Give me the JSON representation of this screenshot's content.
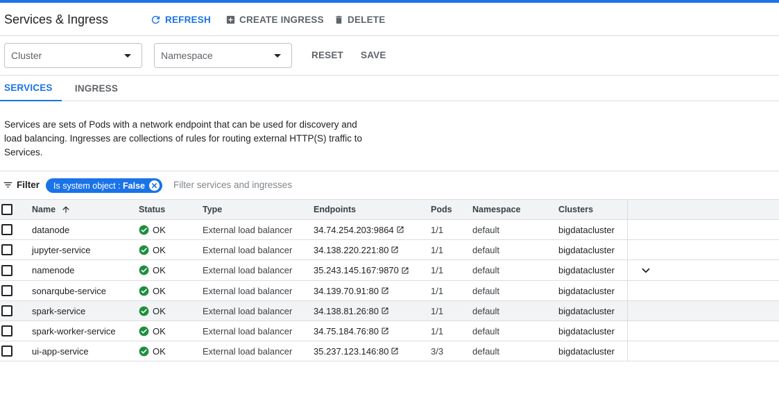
{
  "header": {
    "title": "Services & Ingress",
    "refresh_label": "REFRESH",
    "create_label": "CREATE INGRESS",
    "delete_label": "DELETE"
  },
  "filters": {
    "cluster_label": "Cluster",
    "namespace_label": "Namespace",
    "reset_label": "RESET",
    "save_label": "SAVE"
  },
  "tabs": [
    {
      "label": "SERVICES",
      "active": true
    },
    {
      "label": "INGRESS",
      "active": false
    }
  ],
  "description": "Services are sets of Pods with a network endpoint that can be used for discovery and load balancing. Ingresses are collections of rules for routing external HTTP(S) traffic to Services.",
  "filterbar": {
    "label": "Filter",
    "chip_key": "Is system object : ",
    "chip_value": "False",
    "placeholder": "Filter services and ingresses"
  },
  "table": {
    "columns": {
      "name": "Name",
      "status": "Status",
      "type": "Type",
      "endpoints": "Endpoints",
      "pods": "Pods",
      "namespace": "Namespace",
      "clusters": "Clusters"
    },
    "rows": [
      {
        "name": "datanode",
        "status": "OK",
        "type": "External load balancer",
        "endpoint": "34.74.254.203:9864",
        "pods": "1/1",
        "namespace": "default",
        "cluster": "bigdatacluster"
      },
      {
        "name": "jupyter-service",
        "status": "OK",
        "type": "External load balancer",
        "endpoint": "34.138.220.221:80",
        "pods": "1/1",
        "namespace": "default",
        "cluster": "bigdatacluster"
      },
      {
        "name": "namenode",
        "status": "OK",
        "type": "External load balancer",
        "endpoint": "35.243.145.167:9870",
        "pods": "1/1",
        "namespace": "default",
        "cluster": "bigdatacluster"
      },
      {
        "name": "sonarqube-service",
        "status": "OK",
        "type": "External load balancer",
        "endpoint": "34.139.70.91:80",
        "pods": "1/1",
        "namespace": "default",
        "cluster": "bigdatacluster"
      },
      {
        "name": "spark-service",
        "status": "OK",
        "type": "External load balancer",
        "endpoint": "34.138.81.26:80",
        "pods": "1/1",
        "namespace": "default",
        "cluster": "bigdatacluster"
      },
      {
        "name": "spark-worker-service",
        "status": "OK",
        "type": "External load balancer",
        "endpoint": "34.75.184.76:80",
        "pods": "1/1",
        "namespace": "default",
        "cluster": "bigdatacluster"
      },
      {
        "name": "ui-app-service",
        "status": "OK",
        "type": "External load balancer",
        "endpoint": "35.237.123.146:80",
        "pods": "3/3",
        "namespace": "default",
        "cluster": "bigdatacluster"
      }
    ]
  },
  "colors": {
    "accent": "#1a73e8",
    "ok_green": "#1e8e3e"
  },
  "icons": [
    "refresh-icon",
    "add-box-icon",
    "trash-icon",
    "caret-down-icon",
    "filter-list-icon",
    "close-circle-icon",
    "sort-arrow-up-icon",
    "check-circle-icon",
    "open-external-icon",
    "chevron-down-icon"
  ]
}
